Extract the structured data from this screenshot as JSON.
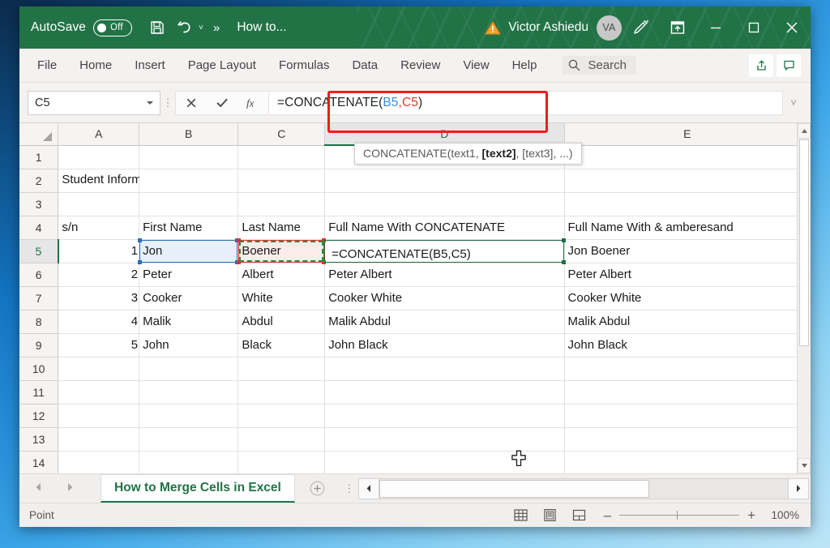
{
  "titlebar": {
    "autosave_label": "AutoSave",
    "autosave_state": "Off",
    "save_icon": "save-icon",
    "undo_icon": "undo-icon",
    "more_icon": "chevron-double-right-icon",
    "document_title": "How to...",
    "warning_icon": "warning-triangle-icon",
    "account_name": "Victor Ashiedu",
    "account_initials": "VA",
    "ink_icon": "pen-ink-icon",
    "ribbon_display_icon": "ribbon-display-options-icon",
    "minimize_icon": "minimize-icon",
    "maximize_icon": "maximize-icon",
    "close_icon": "close-icon",
    "accent_color": "#217346"
  },
  "ribbon": {
    "tabs": [
      "File",
      "Home",
      "Insert",
      "Page Layout",
      "Formulas",
      "Data",
      "Review",
      "View",
      "Help"
    ],
    "search_label": "Search",
    "search_icon": "search-icon",
    "share_icon": "share-icon",
    "comments_icon": "comment-icon"
  },
  "formula_bar": {
    "name_box_value": "C5",
    "cancel_icon": "cancel-x-icon",
    "enter_icon": "enter-check-icon",
    "function_icon": "insert-function-fx-icon",
    "formula_parts": {
      "prefix": "=CONCATENATE(",
      "ref1": "B5",
      "comma": ",",
      "ref2": "C5",
      "suffix": ")"
    },
    "formula_full": "=CONCATENATE(B5,C5)",
    "highlight_color": "#ee1c1c",
    "ref1_color": "#3a8ddb",
    "ref2_color": "#e03b2d"
  },
  "tooltip": {
    "prefix": "CONCATENATE(text1, ",
    "bold": "[text2]",
    "suffix": ", [text3], ...)"
  },
  "grid": {
    "columns": [
      "A",
      "B",
      "C",
      "D",
      "E"
    ],
    "selected_column": "D",
    "selected_row": "5",
    "rows": [
      {
        "n": "1",
        "a": "",
        "b": "",
        "c": "",
        "d": "",
        "e": ""
      },
      {
        "n": "2",
        "a": "Student Information",
        "b": "",
        "c": "",
        "d": "",
        "e": ""
      },
      {
        "n": "3",
        "a": "",
        "b": "",
        "c": "",
        "d": "",
        "e": ""
      },
      {
        "n": "4",
        "a": "s/n",
        "b": "First Name",
        "c": "Last Name",
        "d": "Full Name With CONCATENATE",
        "e": "Full Name With & amberesand"
      },
      {
        "n": "5",
        "a": "1",
        "b": "Jon",
        "c": "Boener",
        "d": "=CONCATENATE(B5,C5)",
        "e": "Jon Boener"
      },
      {
        "n": "6",
        "a": "2",
        "b": "Peter",
        "c": "Albert",
        "d": "Peter Albert",
        "e": "Peter Albert"
      },
      {
        "n": "7",
        "a": "3",
        "b": "Cooker",
        "c": "White",
        "d": "Cooker White",
        "e": "Cooker White"
      },
      {
        "n": "8",
        "a": "4",
        "b": "Malik",
        "c": "Abdul",
        "d": "Malik Abdul",
        "e": "Malik Abdul"
      },
      {
        "n": "9",
        "a": "5",
        "b": "John",
        "c": "Black",
        "d": "John Black",
        "e": "John Black"
      },
      {
        "n": "10",
        "a": "",
        "b": "",
        "c": "",
        "d": "",
        "e": ""
      },
      {
        "n": "11",
        "a": "",
        "b": "",
        "c": "",
        "d": "",
        "e": ""
      },
      {
        "n": "12",
        "a": "",
        "b": "",
        "c": "",
        "d": "",
        "e": ""
      },
      {
        "n": "13",
        "a": "",
        "b": "",
        "c": "",
        "d": "",
        "e": ""
      },
      {
        "n": "14",
        "a": "",
        "b": "",
        "c": "",
        "d": "",
        "e": ""
      }
    ],
    "selection_colors": {
      "b5_border": "#2c6fbb",
      "b5_fill": "#e7eff9",
      "c5_border": "#d5372a",
      "c5_fill": "#faeceb",
      "marching_ants": "#2f8a42",
      "d5_border": "#1e7145"
    },
    "cursor_icon": "cell-select-cross-cursor"
  },
  "tabbar": {
    "prev_icon": "nav-prev-icon",
    "next_icon": "nav-next-icon",
    "sheet_name": "How to Merge Cells in Excel",
    "add_sheet_icon": "add-sheet-plus-icon",
    "scroll_left_icon": "scroll-left-icon",
    "scroll_right_icon": "scroll-right-icon"
  },
  "statusbar": {
    "mode": "Point",
    "normal_view_icon": "normal-view-icon",
    "page_layout_icon": "page-layout-view-icon",
    "page_break_icon": "page-break-preview-icon",
    "zoom_out_label": "–",
    "zoom_in_label": "+",
    "zoom_level": "100%"
  }
}
